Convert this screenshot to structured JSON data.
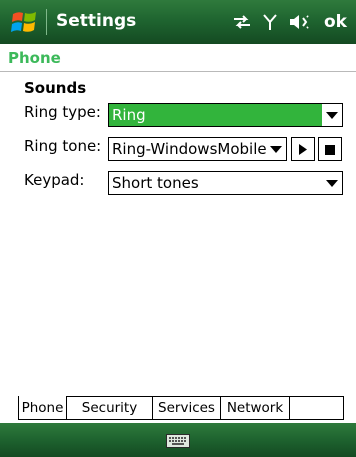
{
  "titlebar": {
    "title": "Settings",
    "ok_label": "ok",
    "icons": [
      "windows-start-icon",
      "connectivity-icon",
      "signal-antenna-icon",
      "volume-icon"
    ],
    "colors": {
      "bar": "#1f6530",
      "text": "#ffffff"
    }
  },
  "page": {
    "title": "Phone",
    "title_color": "#3cb95a"
  },
  "sounds": {
    "section_title": "Sounds",
    "ring_type": {
      "label": "Ring type:",
      "value": "Ring"
    },
    "ring_tone": {
      "label": "Ring tone:",
      "value": "Ring-WindowsMobile",
      "play_icon": "play-icon",
      "stop_icon": "stop-icon"
    },
    "keypad": {
      "label": "Keypad:",
      "value": "Short tones"
    },
    "selected_color": "#32b43c"
  },
  "tabs": [
    {
      "label": "Phone",
      "active": true
    },
    {
      "label": "Security",
      "active": false
    },
    {
      "label": "Services",
      "active": false
    },
    {
      "label": "Network",
      "active": false
    }
  ],
  "softbar": {
    "icon": "keyboard-icon"
  }
}
